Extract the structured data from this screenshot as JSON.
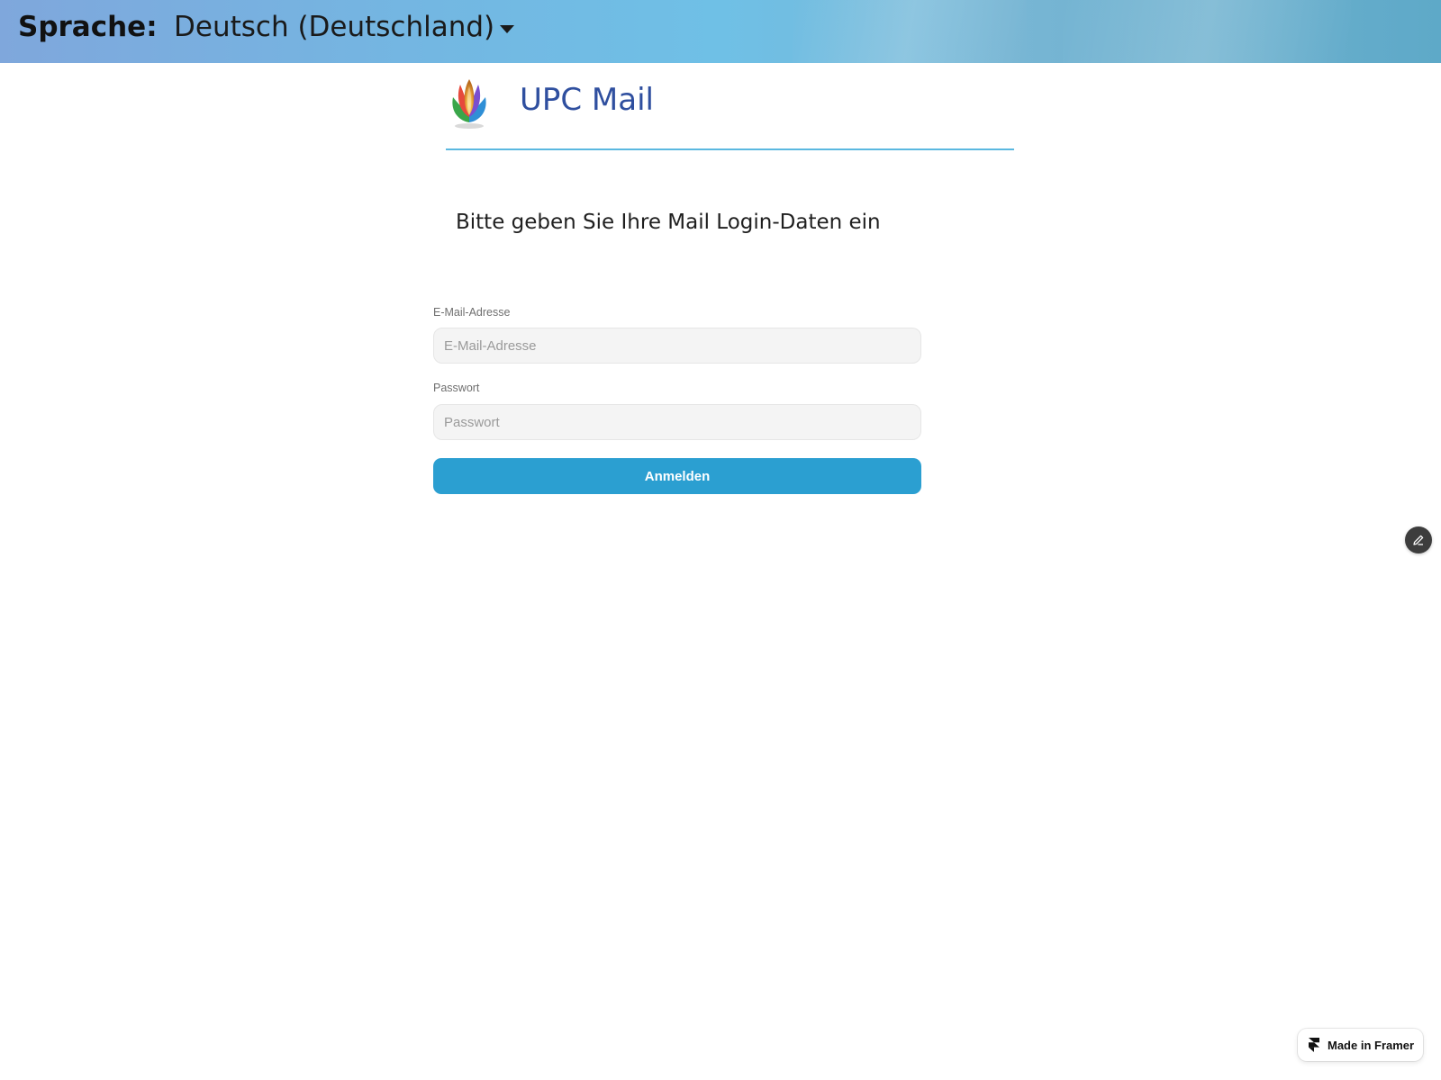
{
  "header": {
    "language_label": "Sprache:",
    "language_selected": "Deutsch (Deutschland)"
  },
  "brand": {
    "name": "UPC Mail"
  },
  "login": {
    "heading": "Bitte geben Sie Ihre Mail Login-Daten ein",
    "email_label": "E-Mail-Adresse",
    "email_placeholder": "E-Mail-Adresse",
    "email_value": "",
    "password_label": "Passwort",
    "password_placeholder": "Passwort",
    "password_value": "",
    "submit_label": "Anmelden"
  },
  "badge": {
    "label": "Made in Framer"
  },
  "colors": {
    "accent": "#2b9fd1",
    "brand_text": "#2f4f9f",
    "divider": "#5bb8e0"
  },
  "icons": [
    "chevron-down-icon",
    "upc-logo",
    "pencil-icon",
    "framer-logo-icon"
  ]
}
